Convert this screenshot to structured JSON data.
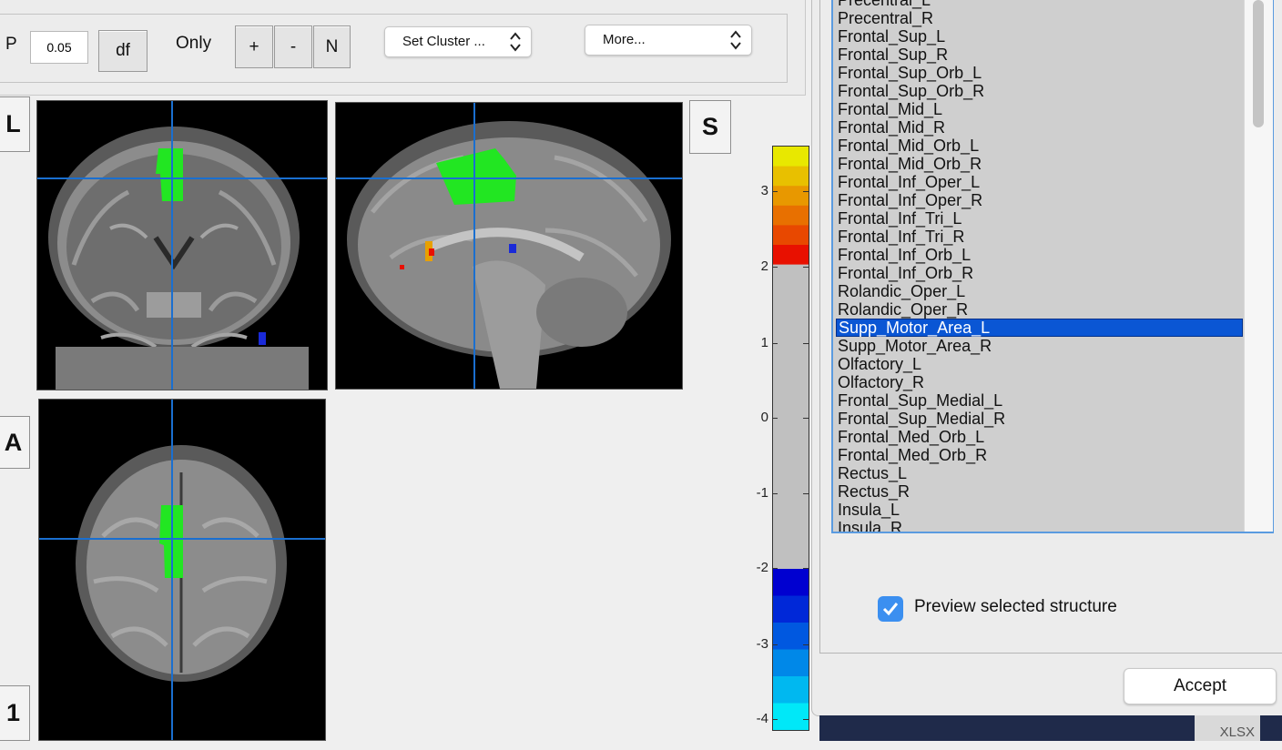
{
  "toolbar": {
    "p_label": "P",
    "p_value": "0.05",
    "df_label": "df",
    "only_label": "Only",
    "plus_label": "+",
    "minus_label": "-",
    "n_label": "N",
    "set_cluster": "Set Cluster ...",
    "more": "More..."
  },
  "views": {
    "coronal_badge": "L",
    "sagittal_badge": "S",
    "axial_badge": "A",
    "slice_badge": "1"
  },
  "colorbar": {
    "ticks": [
      "3",
      "2",
      "1",
      "0",
      "-1",
      "-2",
      "-3",
      "-4"
    ],
    "colors": {
      "hot": [
        "#e8e800",
        "#e8c000",
        "#e89800",
        "#e87000",
        "#e84800",
        "#e81000"
      ],
      "cool": [
        "#0000d0",
        "#0028d8",
        "#0058e0",
        "#0088e8",
        "#00b8f0",
        "#00e8f8"
      ],
      "neutral": "#c0c0c0"
    }
  },
  "structures": {
    "items": [
      "Precentral_L",
      "Precentral_R",
      "Frontal_Sup_L",
      "Frontal_Sup_R",
      "Frontal_Sup_Orb_L",
      "Frontal_Sup_Orb_R",
      "Frontal_Mid_L",
      "Frontal_Mid_R",
      "Frontal_Mid_Orb_L",
      "Frontal_Mid_Orb_R",
      "Frontal_Inf_Oper_L",
      "Frontal_Inf_Oper_R",
      "Frontal_Inf_Tri_L",
      "Frontal_Inf_Tri_R",
      "Frontal_Inf_Orb_L",
      "Frontal_Inf_Orb_R",
      "Rolandic_Oper_L",
      "Rolandic_Oper_R",
      "Supp_Motor_Area_L",
      "Supp_Motor_Area_R",
      "Olfactory_L",
      "Olfactory_R",
      "Frontal_Sup_Medial_L",
      "Frontal_Sup_Medial_R",
      "Frontal_Med_Orb_L",
      "Frontal_Med_Orb_R",
      "Rectus_L",
      "Rectus_R",
      "Insula_L",
      "Insula_R"
    ],
    "selected": "Supp_Motor_Area_L"
  },
  "preview": {
    "label": "Preview selected structure",
    "checked": true
  },
  "accept_label": "Accept",
  "desktop_file": "XLSX",
  "colors": {
    "accent": "#0a56d4",
    "highlight": "#22e622",
    "crosshair": "#1a6fd0"
  }
}
